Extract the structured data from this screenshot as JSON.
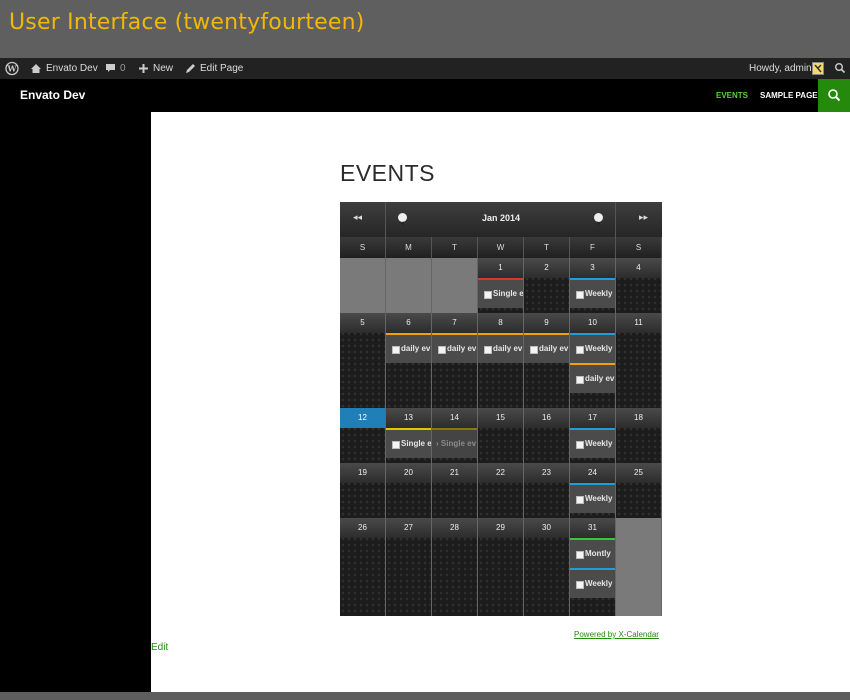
{
  "banner": {
    "title": "User Interface (twentyfourteen)"
  },
  "adminbar": {
    "site_name": "Envato Dev",
    "comments_count": "0",
    "new_label": "New",
    "edit_label": "Edit Page",
    "howdy": "Howdy, admin"
  },
  "header": {
    "site_title": "Envato Dev",
    "nav": [
      {
        "label": "EVENTS",
        "color": "#5fce3c"
      },
      {
        "label": "SAMPLE PAGE",
        "color": "#ffffff"
      }
    ]
  },
  "page": {
    "title": "EVENTS",
    "edit_link": "Edit"
  },
  "calendar": {
    "month_label": "Jan  2014",
    "prev_year": "◂◂",
    "next_year": "▸▸",
    "weekdays": [
      "S",
      "M",
      "T",
      "W",
      "T",
      "F",
      "S"
    ],
    "weeks": [
      [
        {
          "day": "",
          "other": true,
          "events": []
        },
        {
          "day": "",
          "other": true,
          "events": []
        },
        {
          "day": "",
          "other": true,
          "events": []
        },
        {
          "day": "1",
          "events": [
            {
              "label": "Single e",
              "color": "#d9362e"
            }
          ]
        },
        {
          "day": "2",
          "events": []
        },
        {
          "day": "3",
          "events": [
            {
              "label": "Weekly",
              "color": "#1e9ed8"
            }
          ]
        },
        {
          "day": "4",
          "events": []
        }
      ],
      [
        {
          "day": "5",
          "events": []
        },
        {
          "day": "6",
          "events": [
            {
              "label": "daily ev",
              "color": "#f2a007"
            }
          ]
        },
        {
          "day": "7",
          "events": [
            {
              "label": "daily ev",
              "color": "#f2a007"
            }
          ]
        },
        {
          "day": "8",
          "events": [
            {
              "label": "daily ev",
              "color": "#f2a007"
            }
          ]
        },
        {
          "day": "9",
          "events": [
            {
              "label": "daily ev",
              "color": "#f2a007"
            }
          ]
        },
        {
          "day": "10",
          "events": [
            {
              "label": "Weekly",
              "color": "#1e9ed8"
            },
            {
              "label": "daily ev",
              "color": "#f2a007"
            }
          ]
        },
        {
          "day": "11",
          "events": []
        }
      ],
      [
        {
          "day": "12",
          "today": true,
          "events": []
        },
        {
          "day": "13",
          "events": [
            {
              "label": "Single e",
              "color": "#e5c300"
            }
          ]
        },
        {
          "day": "14",
          "events": [
            {
              "label": "› Single ev",
              "color": "#8a7a00",
              "faded": true
            }
          ]
        },
        {
          "day": "15",
          "events": []
        },
        {
          "day": "16",
          "events": []
        },
        {
          "day": "17",
          "events": [
            {
              "label": "Weekly",
              "color": "#1e9ed8"
            }
          ]
        },
        {
          "day": "18",
          "events": []
        }
      ],
      [
        {
          "day": "19",
          "events": []
        },
        {
          "day": "20",
          "events": []
        },
        {
          "day": "21",
          "events": []
        },
        {
          "day": "22",
          "events": []
        },
        {
          "day": "23",
          "events": []
        },
        {
          "day": "24",
          "events": [
            {
              "label": "Weekly",
              "color": "#1e9ed8"
            }
          ]
        },
        {
          "day": "25",
          "events": []
        }
      ],
      [
        {
          "day": "26",
          "events": []
        },
        {
          "day": "27",
          "events": []
        },
        {
          "day": "28",
          "events": []
        },
        {
          "day": "29",
          "events": []
        },
        {
          "day": "30",
          "events": []
        },
        {
          "day": "31",
          "events": [
            {
              "label": "Montly",
              "color": "#3cc43c"
            },
            {
              "label": "Weekly",
              "color": "#1e9ed8"
            }
          ]
        },
        {
          "day": "",
          "other": true,
          "events": []
        }
      ]
    ],
    "powered_by": "Powered by X-Calendar"
  }
}
